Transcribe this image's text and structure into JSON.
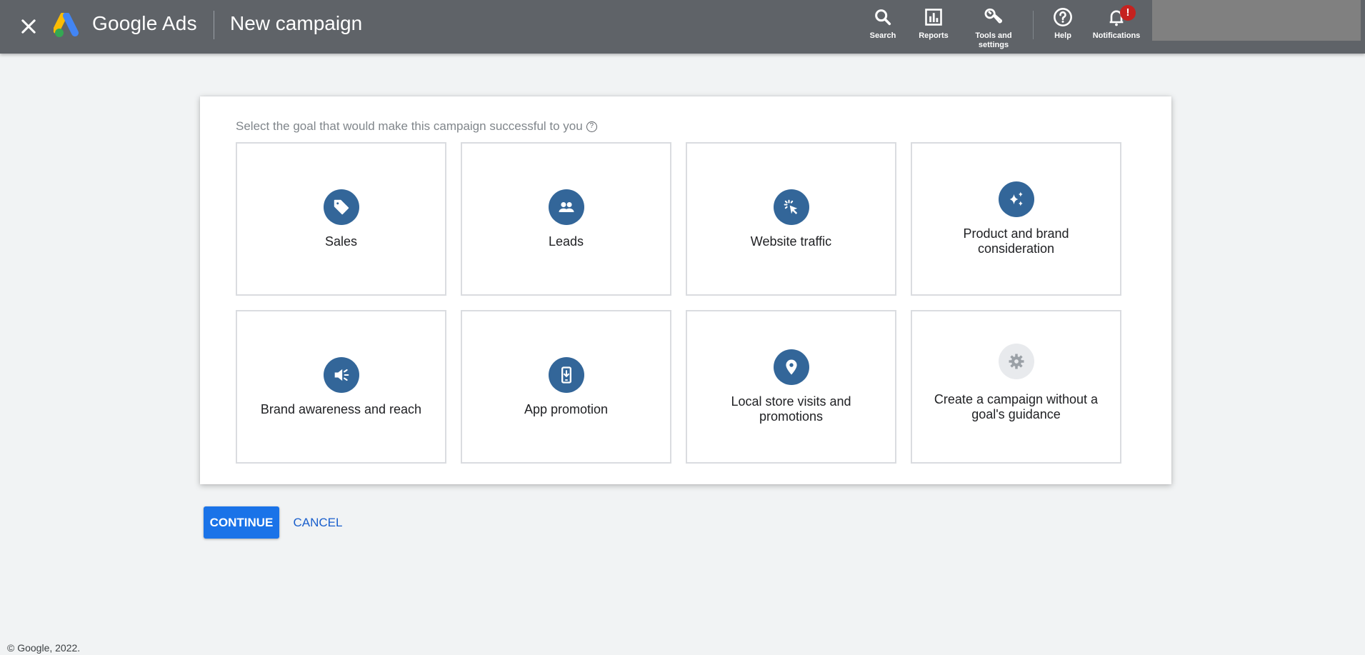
{
  "header": {
    "brand": "Google Ads",
    "page_title": "New campaign",
    "close_icon": "close-icon",
    "nav": [
      {
        "id": "search",
        "label": "Search",
        "icon": "search-icon"
      },
      {
        "id": "reports",
        "label": "Reports",
        "icon": "bar-chart-icon"
      },
      {
        "id": "tools",
        "label": "Tools and settings",
        "icon": "wrench-icon"
      },
      {
        "id": "help",
        "label": "Help",
        "icon": "help-circle-icon"
      },
      {
        "id": "notifications",
        "label": "Notifications",
        "icon": "bell-icon",
        "badge": "!"
      }
    ]
  },
  "goal_panel": {
    "prompt": "Select the goal that would make this campaign successful to you",
    "help_glyph": "?",
    "goals": [
      {
        "label": "Sales",
        "icon": "price-tag-icon"
      },
      {
        "label": "Leads",
        "icon": "people-icon"
      },
      {
        "label": "Website traffic",
        "icon": "cursor-click-icon"
      },
      {
        "label": "Product and brand consideration",
        "icon": "sparkle-icon"
      },
      {
        "label": "Brand awareness and reach",
        "icon": "megaphone-icon"
      },
      {
        "label": "App promotion",
        "icon": "phone-download-icon"
      },
      {
        "label": "Local store visits and promotions",
        "icon": "location-pin-icon"
      },
      {
        "label": "Create a campaign without a goal's guidance",
        "icon": "gear-icon"
      }
    ]
  },
  "actions": {
    "continue_label": "CONTINUE",
    "cancel_label": "CANCEL"
  },
  "footer": {
    "copyright": "© Google, 2022."
  },
  "colors": {
    "header_bg": "#5f6368",
    "icon_circle": "#336699",
    "primary_button": "#1a73e8",
    "badge": "#c5221f"
  }
}
